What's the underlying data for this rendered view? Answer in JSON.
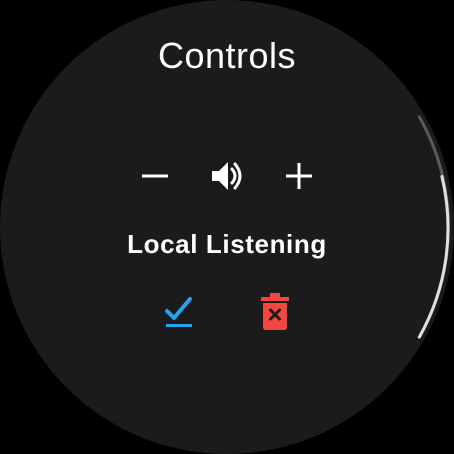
{
  "screen": {
    "title": "Controls",
    "session_label": "Local Listening"
  },
  "controls": {
    "volume_down_icon": "minus-icon",
    "volume_icon": "speaker-volume-icon",
    "volume_up_icon": "plus-icon",
    "accept_icon": "check-underline-icon",
    "delete_icon": "trash-x-icon"
  },
  "colors": {
    "background": "#1b1b1b",
    "text": "#ffffff",
    "accept": "#2aa3ef",
    "delete": "#f2463e",
    "scroll_track": "#5a5a5a",
    "scroll_thumb": "#e0e0e0"
  }
}
